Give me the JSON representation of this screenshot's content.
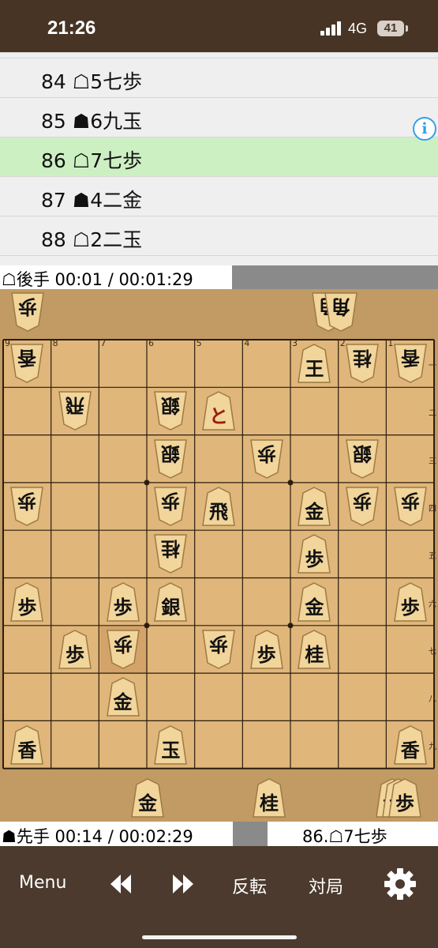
{
  "status_bar": {
    "time": "21:26",
    "network": "4G",
    "battery": "41"
  },
  "move_list": {
    "moves": [
      {
        "number": "84",
        "side": "☖",
        "text": "5七歩"
      },
      {
        "number": "85",
        "side": "☗",
        "text": "6九玉"
      },
      {
        "number": "86",
        "side": "☖",
        "text": "7七歩"
      },
      {
        "number": "87",
        "side": "☗",
        "text": "4二金"
      },
      {
        "number": "88",
        "side": "☖",
        "text": "2二玉"
      }
    ],
    "active_index": 2,
    "info_icon": "i"
  },
  "gote": {
    "timer": "☖後手 00:01 / 00:01:29",
    "hand": [
      "歩",
      "角",
      "角"
    ]
  },
  "sente": {
    "timer": "☗先手 00:14 / 00:02:29",
    "hand": [
      "金",
      "桂",
      "歩",
      "歩",
      "歩"
    ]
  },
  "board": {
    "column_numbers": [
      "9",
      "8",
      "7",
      "6",
      "5",
      "4",
      "3",
      "2",
      "1"
    ],
    "row_numbers": [
      "一",
      "二",
      "三",
      "四",
      "五",
      "六",
      "七",
      "八",
      "九"
    ],
    "pieces": [
      {
        "col": 9,
        "row": 1,
        "char": "香",
        "owner": "gote"
      },
      {
        "col": 3,
        "row": 1,
        "char": "王",
        "owner": "sente"
      },
      {
        "col": 2,
        "row": 1,
        "char": "桂",
        "owner": "gote"
      },
      {
        "col": 1,
        "row": 1,
        "char": "香",
        "owner": "gote"
      },
      {
        "col": 8,
        "row": 2,
        "char": "飛",
        "owner": "gote"
      },
      {
        "col": 6,
        "row": 2,
        "char": "銀",
        "owner": "gote"
      },
      {
        "col": 5,
        "row": 2,
        "char": "と",
        "owner": "sente",
        "promoted": true
      },
      {
        "col": 6,
        "row": 3,
        "char": "銀",
        "owner": "gote"
      },
      {
        "col": 4,
        "row": 3,
        "char": "歩",
        "owner": "gote"
      },
      {
        "col": 2,
        "row": 3,
        "char": "銀",
        "owner": "gote"
      },
      {
        "col": 9,
        "row": 4,
        "char": "歩",
        "owner": "gote"
      },
      {
        "col": 6,
        "row": 4,
        "char": "歩",
        "owner": "gote"
      },
      {
        "col": 5,
        "row": 4,
        "char": "飛",
        "owner": "sente"
      },
      {
        "col": 3,
        "row": 4,
        "char": "金",
        "owner": "sente"
      },
      {
        "col": 2,
        "row": 4,
        "char": "歩",
        "owner": "gote"
      },
      {
        "col": 1,
        "row": 4,
        "char": "歩",
        "owner": "gote"
      },
      {
        "col": 6,
        "row": 5,
        "char": "桂",
        "owner": "gote"
      },
      {
        "col": 3,
        "row": 5,
        "char": "歩",
        "owner": "sente"
      },
      {
        "col": 9,
        "row": 6,
        "char": "歩",
        "owner": "sente"
      },
      {
        "col": 7,
        "row": 6,
        "char": "歩",
        "owner": "sente"
      },
      {
        "col": 6,
        "row": 6,
        "char": "銀",
        "owner": "sente"
      },
      {
        "col": 3,
        "row": 6,
        "char": "金",
        "owner": "sente"
      },
      {
        "col": 1,
        "row": 6,
        "char": "歩",
        "owner": "sente"
      },
      {
        "col": 8,
        "row": 7,
        "char": "歩",
        "owner": "sente"
      },
      {
        "col": 7,
        "row": 7,
        "char": "歩",
        "owner": "gote"
      },
      {
        "col": 5,
        "row": 7,
        "char": "歩",
        "owner": "gote"
      },
      {
        "col": 4,
        "row": 7,
        "char": "歩",
        "owner": "sente"
      },
      {
        "col": 3,
        "row": 7,
        "char": "桂",
        "owner": "sente"
      },
      {
        "col": 7,
        "row": 8,
        "char": "金",
        "owner": "sente"
      },
      {
        "col": 9,
        "row": 9,
        "char": "香",
        "owner": "sente"
      },
      {
        "col": 6,
        "row": 9,
        "char": "玉",
        "owner": "sente"
      },
      {
        "col": 1,
        "row": 9,
        "char": "香",
        "owner": "sente"
      }
    ]
  },
  "last_move": "86.☖7七歩",
  "toolbar": {
    "menu": "Menu",
    "rewind_icon": "rewind-icon",
    "forward_icon": "fast-forward-icon",
    "flip": "反転",
    "match": "対局",
    "settings_icon": "gear-icon"
  }
}
